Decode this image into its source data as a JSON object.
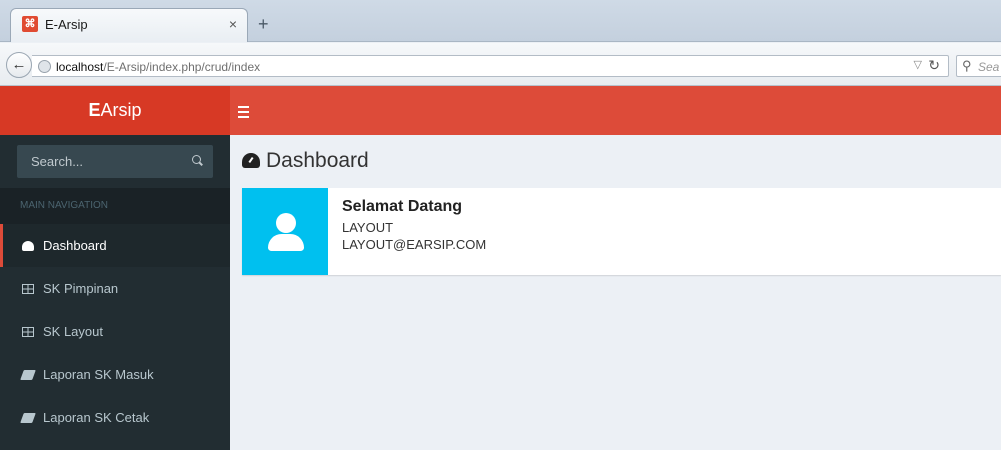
{
  "browser": {
    "tab_title": "E-Arsip",
    "tab_favicon": "app-favicon",
    "tab_close": "×",
    "new_tab": "+",
    "url_host": "localhost",
    "url_path": "/E-Arsip/index.php/crud/index",
    "search_placeholder": "Sea"
  },
  "header": {
    "logo_bold": "E",
    "logo_rest": "Arsip",
    "accent_color": "#dd4b39",
    "logo_color": "#d73925"
  },
  "sidebar": {
    "search_placeholder": "Search...",
    "nav_header": "MAIN NAVIGATION",
    "items": [
      {
        "label": "Dashboard",
        "icon": "dashboard-icon",
        "active": true
      },
      {
        "label": "SK Pimpinan",
        "icon": "table-icon"
      },
      {
        "label": "SK Layout",
        "icon": "table-icon"
      },
      {
        "label": "Laporan SK Masuk",
        "icon": "book-icon"
      },
      {
        "label": "Laporan SK Cetak",
        "icon": "book-icon"
      }
    ]
  },
  "main": {
    "page_title": "Dashboard",
    "info_box": {
      "title": "Selamat Datang",
      "line1": "LAYOUT",
      "line2": "LAYOUT@EARSIP.COM",
      "icon": "user-icon",
      "icon_bg": "#00c0ef"
    }
  }
}
